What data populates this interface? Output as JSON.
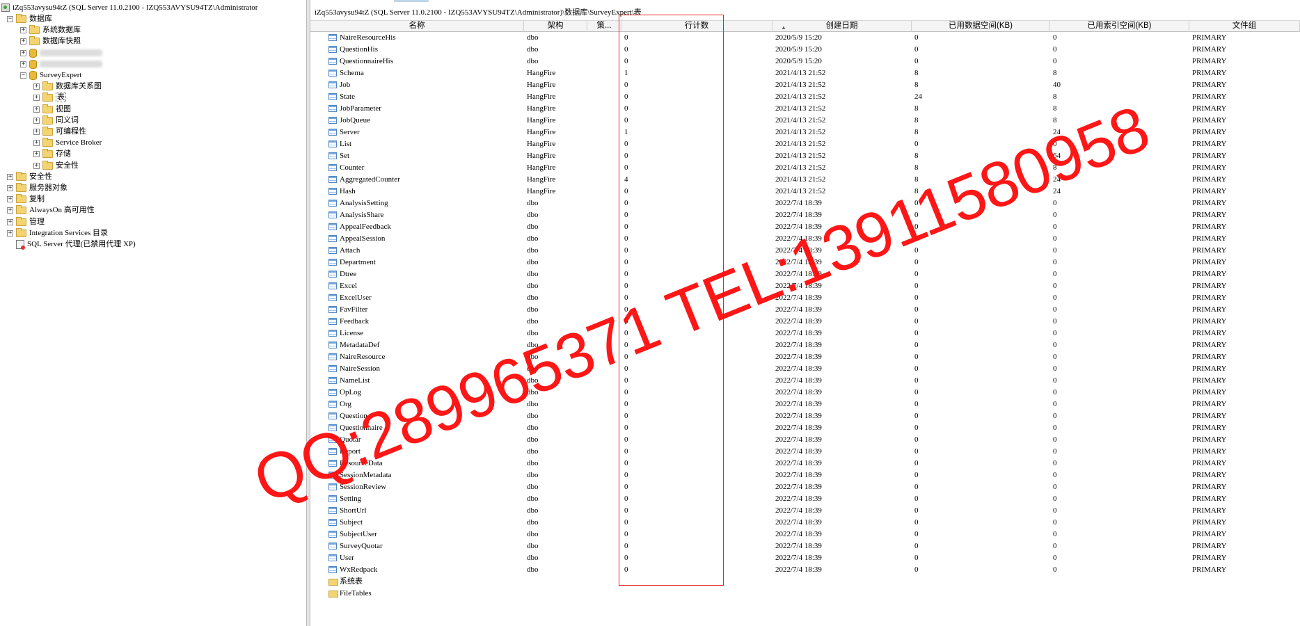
{
  "explorer": {
    "server_label": "iZq553avysu94tZ (SQL Server 11.0.2100 - IZQ553AVYSU94TZ\\Administrator",
    "items": [
      {
        "label": "数据库",
        "indent": 1,
        "toggle": "−",
        "icon": "folder"
      },
      {
        "label": "系统数据库",
        "indent": 2,
        "toggle": "+",
        "icon": "folder"
      },
      {
        "label": "数据库快照",
        "indent": 2,
        "toggle": "+",
        "icon": "folder"
      },
      {
        "label": "",
        "indent": 2,
        "toggle": "+",
        "icon": "db"
      },
      {
        "label": "",
        "indent": 2,
        "toggle": "+",
        "icon": "db"
      },
      {
        "label": "SurveyExpert",
        "indent": 2,
        "toggle": "−",
        "icon": "db"
      },
      {
        "label": "数据库关系图",
        "indent": 3,
        "toggle": "+",
        "icon": "folder"
      },
      {
        "label": "表",
        "indent": 3,
        "toggle": "+",
        "icon": "folder"
      },
      {
        "label": "视图",
        "indent": 3,
        "toggle": "+",
        "icon": "folder"
      },
      {
        "label": "同义词",
        "indent": 3,
        "toggle": "+",
        "icon": "folder"
      },
      {
        "label": "可编程性",
        "indent": 3,
        "toggle": "+",
        "icon": "folder"
      },
      {
        "label": "Service Broker",
        "indent": 3,
        "toggle": "+",
        "icon": "folder"
      },
      {
        "label": "存储",
        "indent": 3,
        "toggle": "+",
        "icon": "folder"
      },
      {
        "label": "安全性",
        "indent": 3,
        "toggle": "+",
        "icon": "folder"
      },
      {
        "label": "安全性",
        "indent": 1,
        "toggle": "+",
        "icon": "folder"
      },
      {
        "label": "服务器对象",
        "indent": 1,
        "toggle": "+",
        "icon": "folder"
      },
      {
        "label": "复制",
        "indent": 1,
        "toggle": "+",
        "icon": "folder"
      },
      {
        "label": "AlwaysOn 高可用性",
        "indent": 1,
        "toggle": "+",
        "icon": "folder"
      },
      {
        "label": "管理",
        "indent": 1,
        "toggle": "+",
        "icon": "folder"
      },
      {
        "label": "Integration Services 目录",
        "indent": 1,
        "toggle": "+",
        "icon": "folder"
      },
      {
        "label": "SQL Server 代理(已禁用代理 XP)",
        "indent": 1,
        "toggle": "",
        "icon": "agent"
      }
    ]
  },
  "details": {
    "path": "iZq553avysu94tZ (SQL Server 11.0.2100 - IZQ553AVYSU94TZ\\Administrator)\\数据库\\SurveyExpert\\表",
    "columns": [
      "名称",
      "架构",
      "策...",
      "行计数",
      "创建日期",
      "已用数据空间(KB)",
      "已用索引空间(KB)",
      "文件组"
    ],
    "rows": [
      [
        "NaireResourceHis",
        "dbo",
        "",
        "0",
        "2020/5/9 15:20",
        "0",
        "0",
        "PRIMARY"
      ],
      [
        "QuestionHis",
        "dbo",
        "",
        "0",
        "2020/5/9 15:20",
        "0",
        "0",
        "PRIMARY"
      ],
      [
        "QuestionnaireHis",
        "dbo",
        "",
        "0",
        "2020/5/9 15:20",
        "0",
        "0",
        "PRIMARY"
      ],
      [
        "Schema",
        "HangFire",
        "",
        "1",
        "2021/4/13 21:52",
        "8",
        "8",
        "PRIMARY"
      ],
      [
        "Job",
        "HangFire",
        "",
        "0",
        "2021/4/13 21:52",
        "8",
        "40",
        "PRIMARY"
      ],
      [
        "State",
        "HangFire",
        "",
        "0",
        "2021/4/13 21:52",
        "24",
        "8",
        "PRIMARY"
      ],
      [
        "JobParameter",
        "HangFire",
        "",
        "0",
        "2021/4/13 21:52",
        "8",
        "8",
        "PRIMARY"
      ],
      [
        "JobQueue",
        "HangFire",
        "",
        "0",
        "2021/4/13 21:52",
        "8",
        "8",
        "PRIMARY"
      ],
      [
        "Server",
        "HangFire",
        "",
        "1",
        "2021/4/13 21:52",
        "8",
        "24",
        "PRIMARY"
      ],
      [
        "List",
        "HangFire",
        "",
        "0",
        "2021/4/13 21:52",
        "0",
        "0",
        "PRIMARY"
      ],
      [
        "Set",
        "HangFire",
        "",
        "0",
        "2021/4/13 21:52",
        "8",
        "64",
        "PRIMARY"
      ],
      [
        "Counter",
        "HangFire",
        "",
        "0",
        "2021/4/13 21:52",
        "8",
        "8",
        "PRIMARY"
      ],
      [
        "AggregatedCounter",
        "HangFire",
        "",
        "4",
        "2021/4/13 21:52",
        "8",
        "24",
        "PRIMARY"
      ],
      [
        "Hash",
        "HangFire",
        "",
        "0",
        "2021/4/13 21:52",
        "8",
        "24",
        "PRIMARY"
      ],
      [
        "AnalysisSetting",
        "dbo",
        "",
        "0",
        "2022/7/4 18:39",
        "0",
        "0",
        "PRIMARY"
      ],
      [
        "AnalysisShare",
        "dbo",
        "",
        "0",
        "2022/7/4 18:39",
        "0",
        "0",
        "PRIMARY"
      ],
      [
        "AppealFeedback",
        "dbo",
        "",
        "0",
        "2022/7/4 18:39",
        "0",
        "0",
        "PRIMARY"
      ],
      [
        "AppealSession",
        "dbo",
        "",
        "0",
        "2022/7/4 18:39",
        "0",
        "0",
        "PRIMARY"
      ],
      [
        "Attach",
        "dbo",
        "",
        "0",
        "2022/7/4 18:39",
        "0",
        "0",
        "PRIMARY"
      ],
      [
        "Department",
        "dbo",
        "",
        "0",
        "2022/7/4 18:39",
        "0",
        "0",
        "PRIMARY"
      ],
      [
        "Dtree",
        "dbo",
        "",
        "0",
        "2022/7/4 18:39",
        "0",
        "0",
        "PRIMARY"
      ],
      [
        "Excel",
        "dbo",
        "",
        "0",
        "2022/7/4 18:39",
        "0",
        "0",
        "PRIMARY"
      ],
      [
        "ExcelUser",
        "dbo",
        "",
        "0",
        "2022/7/4 18:39",
        "0",
        "0",
        "PRIMARY"
      ],
      [
        "FavFilter",
        "dbo",
        "",
        "0",
        "2022/7/4 18:39",
        "0",
        "0",
        "PRIMARY"
      ],
      [
        "Feedback",
        "dbo",
        "",
        "0",
        "2022/7/4 18:39",
        "0",
        "0",
        "PRIMARY"
      ],
      [
        "License",
        "dbo",
        "",
        "0",
        "2022/7/4 18:39",
        "0",
        "0",
        "PRIMARY"
      ],
      [
        "MetadataDef",
        "dbo",
        "",
        "0",
        "2022/7/4 18:39",
        "0",
        "0",
        "PRIMARY"
      ],
      [
        "NaireResource",
        "dbo",
        "",
        "0",
        "2022/7/4 18:39",
        "0",
        "0",
        "PRIMARY"
      ],
      [
        "NaireSession",
        "dbo",
        "",
        "0",
        "2022/7/4 18:39",
        "0",
        "0",
        "PRIMARY"
      ],
      [
        "NameList",
        "dbo",
        "",
        "0",
        "2022/7/4 18:39",
        "0",
        "0",
        "PRIMARY"
      ],
      [
        "OpLog",
        "dbo",
        "",
        "0",
        "2022/7/4 18:39",
        "0",
        "0",
        "PRIMARY"
      ],
      [
        "Org",
        "dbo",
        "",
        "0",
        "2022/7/4 18:39",
        "0",
        "0",
        "PRIMARY"
      ],
      [
        "Question",
        "dbo",
        "",
        "0",
        "2022/7/4 18:39",
        "0",
        "0",
        "PRIMARY"
      ],
      [
        "Questionnaire",
        "dbo",
        "",
        "0",
        "2022/7/4 18:39",
        "0",
        "0",
        "PRIMARY"
      ],
      [
        "Quotar",
        "dbo",
        "",
        "0",
        "2022/7/4 18:39",
        "0",
        "0",
        "PRIMARY"
      ],
      [
        "Report",
        "dbo",
        "",
        "0",
        "2022/7/4 18:39",
        "0",
        "0",
        "PRIMARY"
      ],
      [
        "ResourceData",
        "dbo",
        "",
        "0",
        "2022/7/4 18:39",
        "0",
        "0",
        "PRIMARY"
      ],
      [
        "SessionMetadata",
        "dbo",
        "",
        "0",
        "2022/7/4 18:39",
        "0",
        "0",
        "PRIMARY"
      ],
      [
        "SessionReview",
        "dbo",
        "",
        "0",
        "2022/7/4 18:39",
        "0",
        "0",
        "PRIMARY"
      ],
      [
        "Setting",
        "dbo",
        "",
        "0",
        "2022/7/4 18:39",
        "0",
        "0",
        "PRIMARY"
      ],
      [
        "ShortUrl",
        "dbo",
        "",
        "0",
        "2022/7/4 18:39",
        "0",
        "0",
        "PRIMARY"
      ],
      [
        "Subject",
        "dbo",
        "",
        "0",
        "2022/7/4 18:39",
        "0",
        "0",
        "PRIMARY"
      ],
      [
        "SubjectUser",
        "dbo",
        "",
        "0",
        "2022/7/4 18:39",
        "0",
        "0",
        "PRIMARY"
      ],
      [
        "SurveyQuotar",
        "dbo",
        "",
        "0",
        "2022/7/4 18:39",
        "0",
        "0",
        "PRIMARY"
      ],
      [
        "User",
        "dbo",
        "",
        "0",
        "2022/7/4 18:39",
        "0",
        "0",
        "PRIMARY"
      ],
      [
        "WxRedpack",
        "dbo",
        "",
        "0",
        "2022/7/4 18:39",
        "0",
        "0",
        "PRIMARY"
      ]
    ],
    "folders": [
      "系统表",
      "FileTables"
    ]
  },
  "watermark": "QQ:289965371 TEL:13911580958",
  "colors": {
    "watermark": "#ff0a0a",
    "highlight_box": "#e42020"
  }
}
